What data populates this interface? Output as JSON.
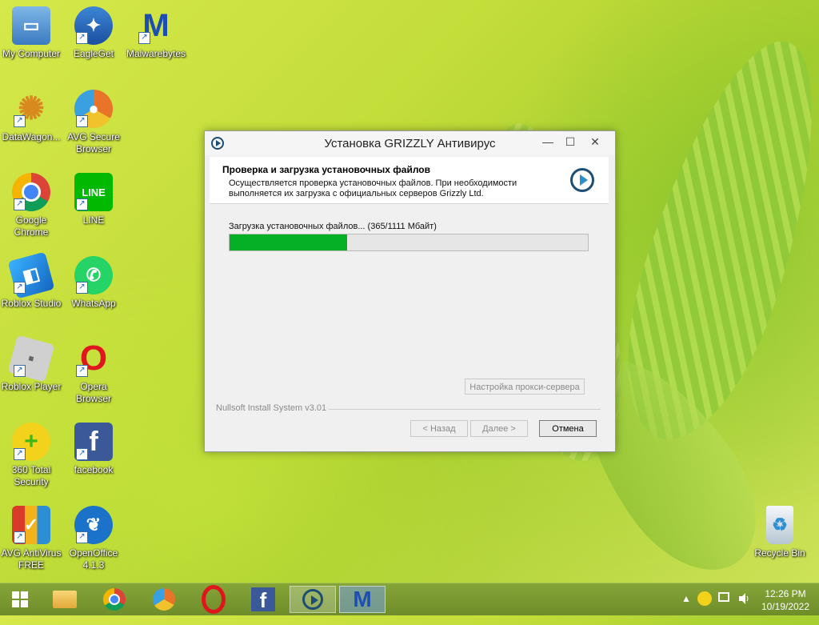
{
  "desktop_icons": [
    {
      "label": "My Computer",
      "icon": "computer-icon",
      "color": "#4a90c8"
    },
    {
      "label": "EagleGet",
      "icon": "eagle-icon",
      "color": "#2a6fc0"
    },
    {
      "label": "Malwarebytes",
      "icon": "malwarebytes-icon",
      "color": "#1c4fb0"
    },
    {
      "label": "DataWagon...",
      "icon": "mandala-icon",
      "color": "#d98a1e"
    },
    {
      "label": "AVG Secure Browser",
      "icon": "avg-browser-icon",
      "color": "#e8742a"
    },
    {
      "label": "Google Chrome",
      "icon": "chrome-icon",
      "color": "#4285f4"
    },
    {
      "label": "LINE",
      "icon": "line-icon",
      "color": "#00b900"
    },
    {
      "label": "Roblox Studio",
      "icon": "roblox-studio-icon",
      "color": "#1e8ee0"
    },
    {
      "label": "WhatsApp",
      "icon": "whatsapp-icon",
      "color": "#25d366"
    },
    {
      "label": "Roblox Player",
      "icon": "roblox-player-icon",
      "color": "#c8c8c8"
    },
    {
      "label": "Opera Browser",
      "icon": "opera-icon",
      "color": "#e0161e"
    },
    {
      "label": "360 Total Security",
      "icon": "360-icon",
      "color": "#3fb618"
    },
    {
      "label": "facebook",
      "icon": "facebook-icon",
      "color": "#3b5998"
    },
    {
      "label": "AVG AntiVirus FREE",
      "icon": "avg-antivirus-icon",
      "color": "#d93b2b"
    },
    {
      "label": "OpenOffice 4.1.3",
      "icon": "openoffice-icon",
      "color": "#1a73c8"
    },
    {
      "label": "Recycle Bin",
      "icon": "recycle-bin-icon",
      "color": "#9ab"
    }
  ],
  "installer": {
    "title": "Установка GRIZZLY Антивирус",
    "minimize": "—",
    "maximize": "☐",
    "close": "✕",
    "header_title": "Проверка и загрузка установочных файлов",
    "header_subtitle": "Осуществляется проверка установочных файлов. При необходимости выполняется их загрузка с официальных серверов Grizzly Ltd.",
    "status": "Загрузка установочных файлов... (365/1111  Мбайт)",
    "progress": 0.329,
    "progress_color": "#06b025",
    "proxy_button": "Настройка прокси-сервера",
    "branding": "Nullsoft Install System v3.01",
    "back_button": "< Назад",
    "next_button": "Далее >",
    "cancel_button": "Отмена"
  },
  "taskbar": {
    "start_icon": "windows-start-icon",
    "pinned": [
      "file-explorer-icon",
      "chrome-icon",
      "avg-browser-icon",
      "opera-icon",
      "facebook-icon",
      "installer-icon",
      "malwarebytes-icon"
    ],
    "clock_time": "12:26 PM",
    "clock_date": "10/19/2022",
    "tray_chevron": "▲"
  }
}
